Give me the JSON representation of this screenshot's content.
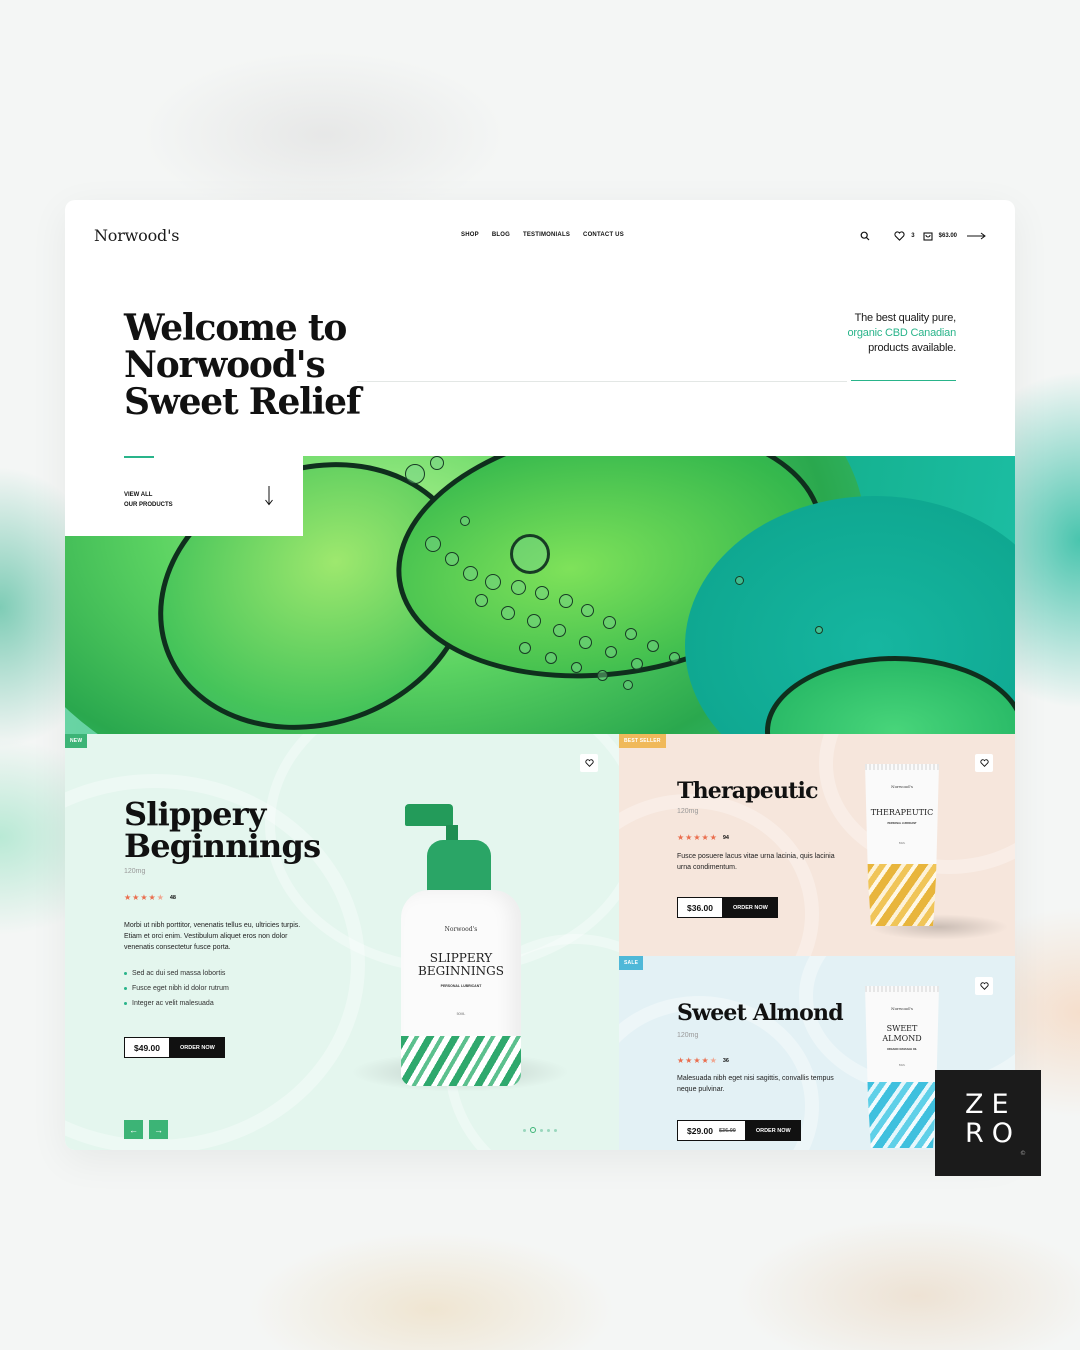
{
  "header": {
    "logo": "Norwood's",
    "nav": [
      "SHOP",
      "BLOG",
      "TESTIMONIALS",
      "CONTACT US"
    ],
    "wishlist_count": "3",
    "cart_total": "$63.00"
  },
  "hero": {
    "title": "Welcome to Norwood's\nSweet Relief",
    "tagline_a": "The best quality pure,",
    "tagline_highlight": "organic CBD Canadian",
    "tagline_b": "products available.",
    "view_all": "VIEW ALL\nOUR PRODUCTS"
  },
  "products": [
    {
      "badge": "NEW",
      "badge_color": "#3cb476",
      "title": "Slippery\nBeginnings",
      "size": "120mg",
      "rating": 4.5,
      "review_count": "48",
      "description": "Morbi ut nibh porttitor, venenatis tellus eu, ultricies turpis. Etiam et orci enim. Vestibulum aliquet eros non dolor venenatis consectetur fusce porta.",
      "bullets": [
        "Sed ac dui sed massa lobortis",
        "Fusce eget nibh id dolor rutrum",
        "Integer ac velit malesuada"
      ],
      "price": "$49.00",
      "order_label": "ORDER NOW",
      "label_brand": "Norwood's",
      "label_name": "SLIPPERY\nBEGINNINGS",
      "label_sub": "PERSONAL LUBRICANT",
      "label_vol": "50ML"
    },
    {
      "badge": "BEST SELLER",
      "badge_color": "#f0b95a",
      "title": "Therapeutic",
      "size": "120mg",
      "rating": 5,
      "review_count": "94",
      "description": "Fusce posuere lacus vitae urna lacinia, quis lacinia urna condimentum.",
      "price": "$36.00",
      "order_label": "ORDER NOW",
      "label_brand": "Norwood's",
      "label_name": "THERAPEUTIC",
      "label_sub": "PERSONAL LUBRICANT",
      "label_vol": "50ML"
    },
    {
      "badge": "SALE",
      "badge_color": "#4fb8d8",
      "title": "Sweet Almond",
      "size": "120mg",
      "rating": 4.5,
      "review_count": "36",
      "description": "Malesuada nibh eget nisi sagittis, convallis tempus neque pulvinar.",
      "price": "$29.00",
      "old_price": "$36.00",
      "order_label": "ORDER NOW",
      "label_brand": "Norwood's",
      "label_name": "SWEET\nALMOND",
      "label_sub": "ORGANIC MASSAGE OIL",
      "label_vol": "50ML"
    }
  ],
  "slider": {
    "prev": "←",
    "next": "→",
    "dot_count": 5,
    "active_dot": 1
  },
  "watermark": {
    "text": "ZE\nRO",
    "mark": "©"
  },
  "colors": {
    "accent": "#29b48a",
    "star": "#ea6d4d"
  }
}
